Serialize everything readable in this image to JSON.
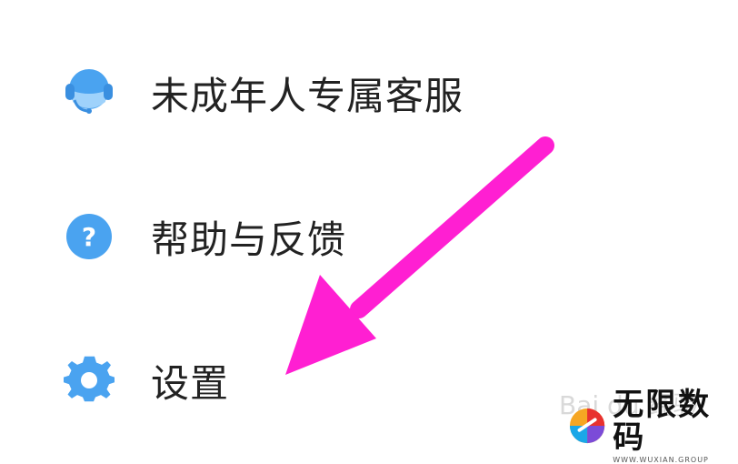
{
  "menu": {
    "items": [
      {
        "label": "未成年人专属客服",
        "icon": "headset-customer-service-icon"
      },
      {
        "label": "帮助与反馈",
        "icon": "question-mark-icon"
      },
      {
        "label": "设置",
        "icon": "gear-icon"
      }
    ]
  },
  "annotation": {
    "arrow_color": "#ff1fd2",
    "arrow_icon": "pointer-arrow-icon"
  },
  "watermark": {
    "baidu_text": "Bai du 经验"
  },
  "brand": {
    "name": "无限数码",
    "url": "WWW.WUXIAN.GROUP"
  },
  "colors": {
    "icon_blue": "#4aa3f0",
    "icon_blue_light": "#7ec0fa",
    "text": "#222222"
  }
}
